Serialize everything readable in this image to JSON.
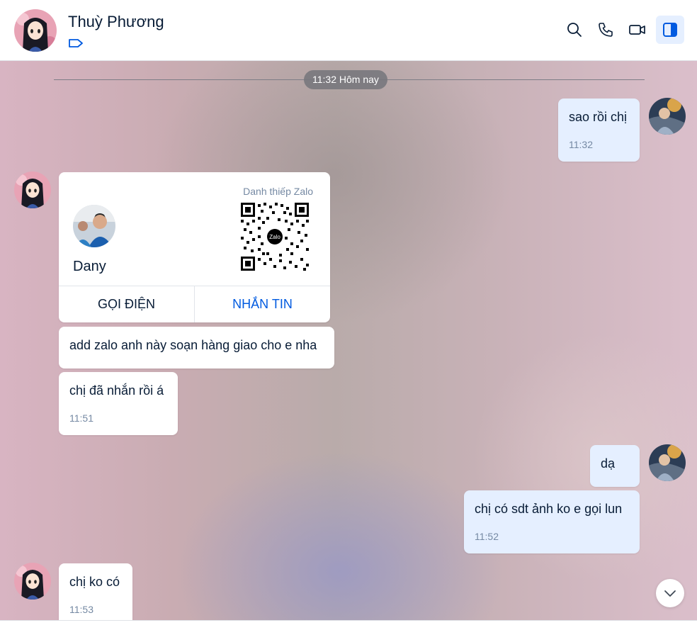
{
  "header": {
    "contact_name": "Thuỳ Phương",
    "icons": [
      "search-icon",
      "phone-icon",
      "video-icon",
      "panel-icon",
      "tag-icon"
    ],
    "accent": "#005ae0"
  },
  "chat": {
    "divider_time": "11:32 Hôm nay",
    "messages": [
      {
        "side": "me",
        "text": "sao rồi chị",
        "time": "11:32"
      },
      {
        "side": "them",
        "text": "add zalo anh này soạn hàng giao cho e nha"
      },
      {
        "side": "them",
        "text": "chị đã nhắn rồi á",
        "time": "11:51"
      },
      {
        "side": "me",
        "text": "dạ"
      },
      {
        "side": "me",
        "text": "chị có sdt ảnh ko e gọi lun",
        "time": "11:52"
      },
      {
        "side": "them",
        "text": "chị ko có",
        "time": "11:53"
      }
    ],
    "card": {
      "type_label": "Danh thiếp Zalo",
      "contact_name": "Dany",
      "qr_badge": "Zalo",
      "call_label": "GỌI ĐIỆN",
      "message_label": "NHẮN TIN"
    }
  }
}
